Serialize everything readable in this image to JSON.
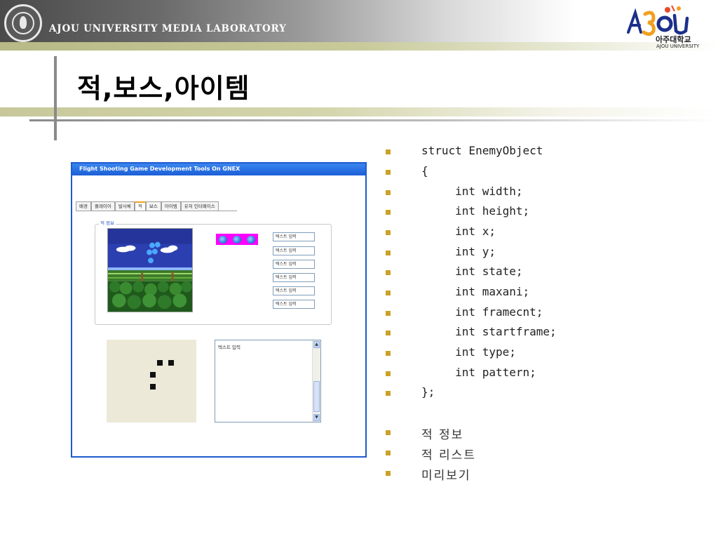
{
  "header": {
    "lab_title": "AJOU UNIVERSITY MEDIA LABORATORY",
    "logo_sub_korean": "아주대학교",
    "logo_sub_english": "AJOU UNIVERSITY",
    "colors": {
      "olive": "#c7c89a",
      "logo_orange": "#f0a020",
      "logo_blue": "#1c2f8a"
    }
  },
  "slide": {
    "title": "적,보스,아이템"
  },
  "window": {
    "title": "Flight Shooting Game Development Tools On GNEX",
    "tabs": [
      "배경",
      "플레이어",
      "발사체",
      "적",
      "보스",
      "아이템",
      "유저 인터페이스"
    ],
    "active_tab": "적",
    "group_label": "적 정보",
    "text_inputs": [
      "텍스트 입력",
      "텍스트 입력",
      "텍스트 입력",
      "텍스트 입력",
      "텍스트 입력",
      "텍스트 입력"
    ],
    "textarea_placeholder": "텍스트 입력"
  },
  "code_lines": [
    "struct EnemyObject",
    "{",
    "     int width;",
    "     int height;",
    "     int x;",
    "     int y;",
    "     int state;",
    "     int maxani;",
    "     int framecnt;",
    "     int startframe;",
    "     int type;",
    "     int pattern;",
    "};"
  ],
  "feature_items": [
    "적 정보",
    "적 리스트",
    "미리보기"
  ]
}
